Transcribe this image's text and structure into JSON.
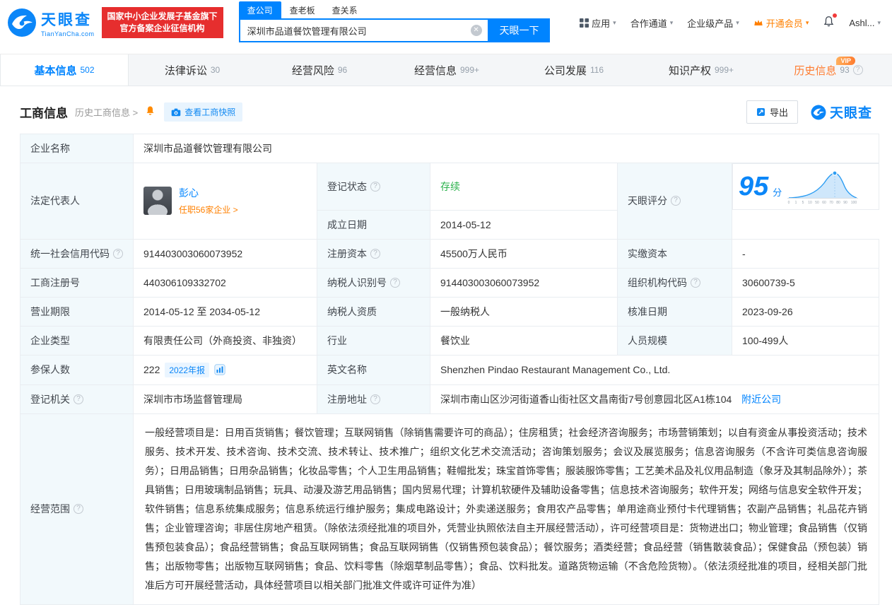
{
  "colors": {
    "primary_blue": "#0084ff",
    "logo_blue": "#0b86f8",
    "badge_red": "#e62e2e",
    "vip_orange": "#ff8000",
    "status_green": "#2bb24c",
    "label_cell_bg": "#f2f9fc"
  },
  "header": {
    "logo": {
      "name": "天眼查",
      "domain": "TianYanCha.com"
    },
    "gov_badge": {
      "line1": "国家中小企业发展子基金旗下",
      "line2": "官方备案企业征信机构"
    },
    "search": {
      "tabs": [
        {
          "label": "查公司"
        },
        {
          "label": "查老板"
        },
        {
          "label": "查关系"
        }
      ],
      "value": "深圳市品道餐饮管理有限公司",
      "button": "天眼一下"
    },
    "nav": {
      "apps": "应用",
      "cooperation": "合作通道",
      "enterprise": "企业级产品",
      "vip": "开通会员",
      "user": "Ashl..."
    }
  },
  "tabs": [
    {
      "label": "基本信息",
      "count": "502"
    },
    {
      "label": "法律诉讼",
      "count": "30"
    },
    {
      "label": "经营风险",
      "count": "96"
    },
    {
      "label": "经营信息",
      "count": "999+"
    },
    {
      "label": "公司发展",
      "count": "116"
    },
    {
      "label": "知识产权",
      "count": "999+"
    },
    {
      "label": "历史信息",
      "count": "93",
      "vip_badge": "VIP"
    }
  ],
  "toolbar": {
    "title": "工商信息",
    "history_link": "历史工商信息 >",
    "snapshot_button": "查看工商快照",
    "export_button": "导出",
    "brand": "天眼查"
  },
  "score_chart": {
    "score": "95",
    "unit": "分",
    "ticks": [
      "0",
      "1",
      "5",
      "10",
      "50",
      "60",
      "70",
      "80",
      "90",
      "100"
    ]
  },
  "fields": {
    "company_name": {
      "label": "企业名称",
      "value": "深圳市品道餐饮管理有限公司"
    },
    "legal_rep": {
      "label": "法定代表人",
      "name": "彭心",
      "link": "任职56家企业 >"
    },
    "reg_status": {
      "label": "登记状态",
      "value": "存续"
    },
    "est_date": {
      "label": "成立日期",
      "value": "2014-05-12"
    },
    "score": {
      "label": "天眼评分"
    },
    "credit_code": {
      "label": "统一社会信用代码",
      "value": "914403003060073952"
    },
    "reg_capital": {
      "label": "注册资本",
      "value": "45500万人民币"
    },
    "paid_capital": {
      "label": "实缴资本",
      "value": "-"
    },
    "reg_number": {
      "label": "工商注册号",
      "value": "440306109332702"
    },
    "taxpayer_id": {
      "label": "纳税人识别号",
      "value": "914403003060073952"
    },
    "org_code": {
      "label": "组织机构代码",
      "value": "30600739-5"
    },
    "business_term": {
      "label": "营业期限",
      "value": "2014-05-12 至 2034-05-12"
    },
    "taxpayer_quality": {
      "label": "纳税人资质",
      "value": "一般纳税人"
    },
    "approval_date": {
      "label": "核准日期",
      "value": "2023-09-26"
    },
    "company_type": {
      "label": "企业类型",
      "value": "有限责任公司（外商投资、非独资）"
    },
    "industry": {
      "label": "行业",
      "value": "餐饮业"
    },
    "staff_size": {
      "label": "人员规模",
      "value": "100-499人"
    },
    "insured": {
      "label": "参保人数",
      "value": "222",
      "report_link": "2022年报"
    },
    "english_name": {
      "label": "英文名称",
      "value": "Shenzhen Pindao Restaurant Management Co., Ltd."
    },
    "reg_authority": {
      "label": "登记机关",
      "value": "深圳市市场监督管理局"
    },
    "reg_address": {
      "label": "注册地址",
      "value": "深圳市南山区沙河街道香山街社区文昌南街7号创意园北区A1栋104",
      "nearby_link": "附近公司"
    },
    "business_scope": {
      "label": "经营范围",
      "value": "一般经营项目是：日用百货销售；餐饮管理；互联网销售（除销售需要许可的商品）；住房租赁；社会经济咨询服务；市场营销策划；以自有资金从事投资活动；技术服务、技术开发、技术咨询、技术交流、技术转让、技术推广；组织文化艺术交流活动；咨询策划服务；会议及展览服务；信息咨询服务（不含许可类信息咨询服务）；日用品销售；日用杂品销售；化妆品零售；个人卫生用品销售；鞋帽批发；珠宝首饰零售；服装服饰零售；工艺美术品及礼仪用品制造（象牙及其制品除外）；茶具销售；日用玻璃制品销售；玩具、动漫及游艺用品销售；国内贸易代理；计算机软硬件及辅助设备零售；信息技术咨询服务；软件开发；网络与信息安全软件开发；软件销售；信息系统集成服务；信息系统运行维护服务；集成电路设计；外卖递送服务；食用农产品零售；单用途商业预付卡代理销售；农副产品销售；礼品花卉销售；企业管理咨询；非居住房地产租赁。（除依法须经批准的项目外，凭营业执照依法自主开展经营活动），许可经营项目是：货物进出口；物业管理；食品销售（仅销售预包装食品）；食品经营销售；食品互联网销售；食品互联网销售（仅销售预包装食品）；餐饮服务；酒类经营；食品经营（销售散装食品）；保健食品（预包装）销售；出版物零售；出版物互联网销售；食品、饮料零售（除烟草制品零售）；食品、饮料批发。道路货物运输（不含危险货物）。（依法须经批准的项目，经相关部门批准后方可开展经营活动，具体经营项目以相关部门批准文件或许可证件为准）"
    }
  }
}
